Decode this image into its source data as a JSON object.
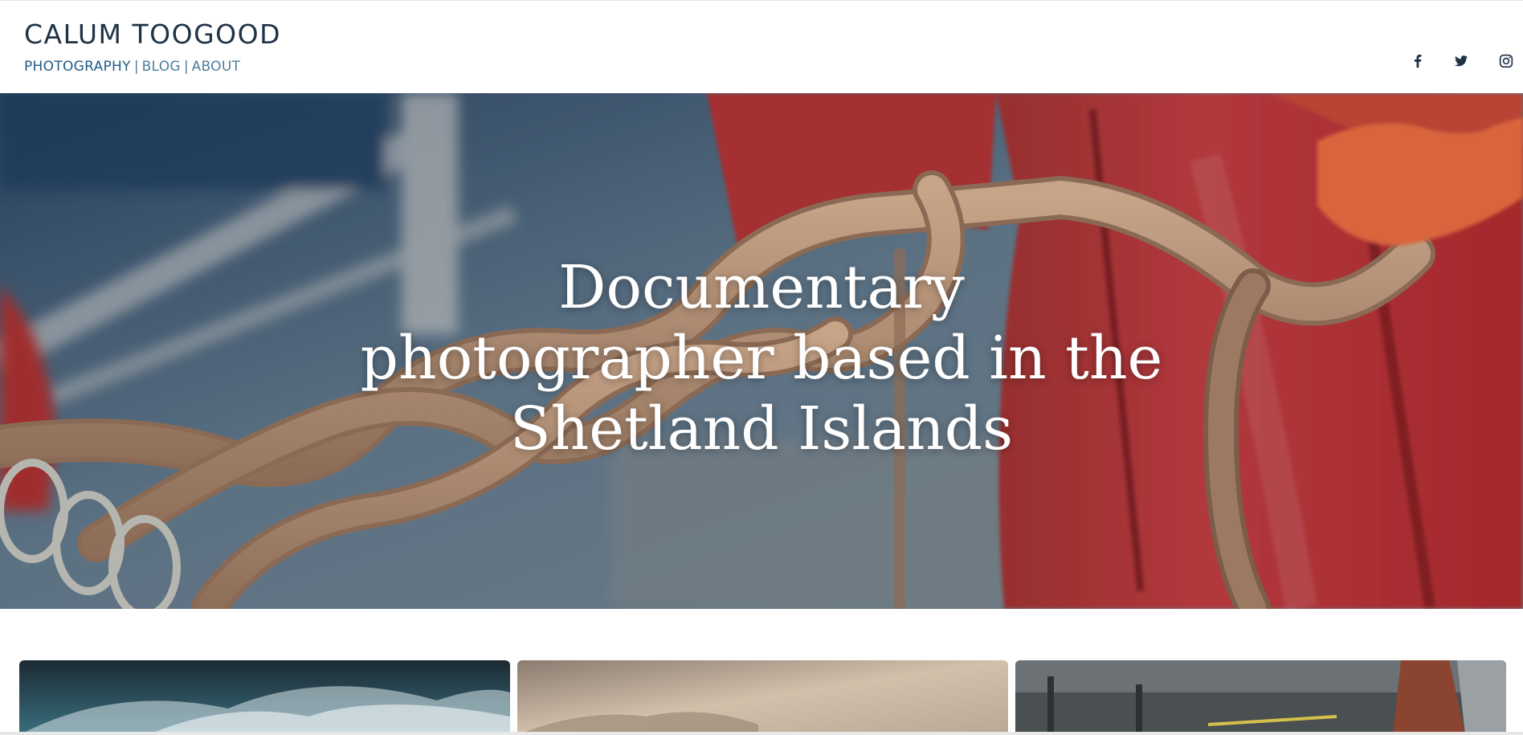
{
  "header": {
    "site_title": "CALUM TOOGOOD",
    "nav": [
      {
        "label": "PHOTOGRAPHY",
        "active": true
      },
      {
        "label": "BLOG",
        "active": false
      },
      {
        "label": "ABOUT",
        "active": false
      }
    ],
    "separator": "|",
    "social": [
      "facebook-icon",
      "twitter-icon",
      "instagram-icon"
    ]
  },
  "hero": {
    "headline_line1": "Documentary",
    "headline_line2": "photographer based in the",
    "headline_line3": "Shetland Islands"
  },
  "gallery": {
    "items": [
      "stormy-sea-photo",
      "misty-coast-photo",
      "fishing-boat-photo"
    ]
  },
  "colors": {
    "title": "#1f3347",
    "nav": "#4d7d9c",
    "nav_active": "#235c85",
    "hero_text": "#ffffff"
  }
}
